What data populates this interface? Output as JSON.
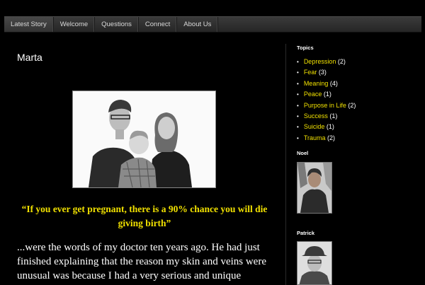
{
  "nav": {
    "items": [
      {
        "label": "Latest Story"
      },
      {
        "label": "Welcome"
      },
      {
        "label": "Questions"
      },
      {
        "label": "Connect"
      },
      {
        "label": "About Us"
      }
    ]
  },
  "post": {
    "title": "Marta",
    "quote": "“If you ever get pregnant, there is a 90% chance you will die giving birth”",
    "body": "...were the words of my doctor ten years ago. He had just finished explaining that the reason my skin and veins were unusual was because I had a very serious and unique"
  },
  "sidebar": {
    "topics_heading": "Topics",
    "topics": [
      {
        "label": "Depression",
        "count": "(2)"
      },
      {
        "label": "Fear",
        "count": "(3)"
      },
      {
        "label": "Meaning",
        "count": "(4)"
      },
      {
        "label": "Peace",
        "count": "(1)"
      },
      {
        "label": "Purpose in Life",
        "count": "(2)"
      },
      {
        "label": "Success",
        "count": "(1)"
      },
      {
        "label": "Suicide",
        "count": "(1)"
      },
      {
        "label": "Trauma",
        "count": "(2)"
      }
    ],
    "authors": [
      {
        "name": "Noel"
      },
      {
        "name": "Patrick"
      }
    ]
  },
  "colors": {
    "background": "#000000",
    "link": "#f0e000",
    "quote": "#f0e000"
  }
}
